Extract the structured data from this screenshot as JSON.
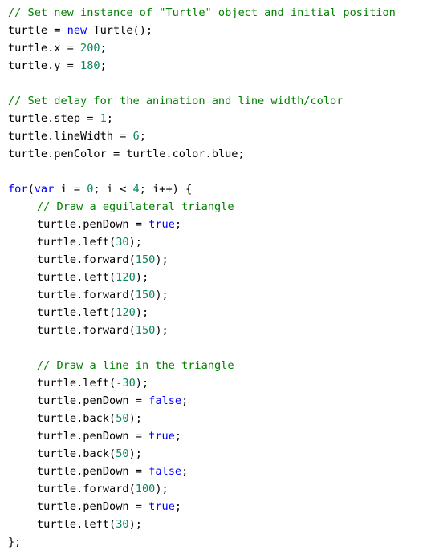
{
  "code": {
    "l1": {
      "comment": "// Set new instance of \"Turtle\" object and initial position"
    },
    "l2": {
      "a": "turtle = ",
      "kw": "new",
      "b": " Turtle();"
    },
    "l3": {
      "a": "turtle.x = ",
      "num": "200",
      "b": ";"
    },
    "l4": {
      "a": "turtle.y = ",
      "num": "180",
      "b": ";"
    },
    "l6": {
      "comment": "// Set delay for the animation and line width/color"
    },
    "l7": {
      "a": "turtle.step = ",
      "num": "1",
      "b": ";"
    },
    "l8": {
      "a": "turtle.lineWidth = ",
      "num": "6",
      "b": ";"
    },
    "l9": {
      "a": "turtle.penColor = turtle.color.blue;"
    },
    "l11": {
      "kw1": "for",
      "a": "(",
      "kw2": "var",
      "b": " i = ",
      "num1": "0",
      "c": "; i < ",
      "num2": "4",
      "d": "; i++) {"
    },
    "l12": {
      "comment": "// Draw a eguilateral triangle"
    },
    "l13": {
      "a": "turtle.penDown = ",
      "kw": "true",
      "b": ";"
    },
    "l14": {
      "a": "turtle.left(",
      "num": "30",
      "b": ");"
    },
    "l15": {
      "a": "turtle.forward(",
      "num": "150",
      "b": ");"
    },
    "l16": {
      "a": "turtle.left(",
      "num": "120",
      "b": ");"
    },
    "l17": {
      "a": "turtle.forward(",
      "num": "150",
      "b": ");"
    },
    "l18": {
      "a": "turtle.left(",
      "num": "120",
      "b": ");"
    },
    "l19": {
      "a": "turtle.forward(",
      "num": "150",
      "b": ");"
    },
    "l21": {
      "comment": "// Draw a line in the triangle"
    },
    "l22": {
      "a": "turtle.left(",
      "num": "-30",
      "b": ");"
    },
    "l23": {
      "a": "turtle.penDown = ",
      "kw": "false",
      "b": ";"
    },
    "l24": {
      "a": "turtle.back(",
      "num": "50",
      "b": ");"
    },
    "l25": {
      "a": "turtle.penDown = ",
      "kw": "true",
      "b": ";"
    },
    "l26": {
      "a": "turtle.back(",
      "num": "50",
      "b": ");"
    },
    "l27": {
      "a": "turtle.penDown = ",
      "kw": "false",
      "b": ";"
    },
    "l28": {
      "a": "turtle.forward(",
      "num": "100",
      "b": ");"
    },
    "l29": {
      "a": "turtle.penDown = ",
      "kw": "true",
      "b": ";"
    },
    "l30": {
      "a": "turtle.left(",
      "num": "30",
      "b": ");"
    },
    "l31": {
      "a": "};"
    }
  }
}
